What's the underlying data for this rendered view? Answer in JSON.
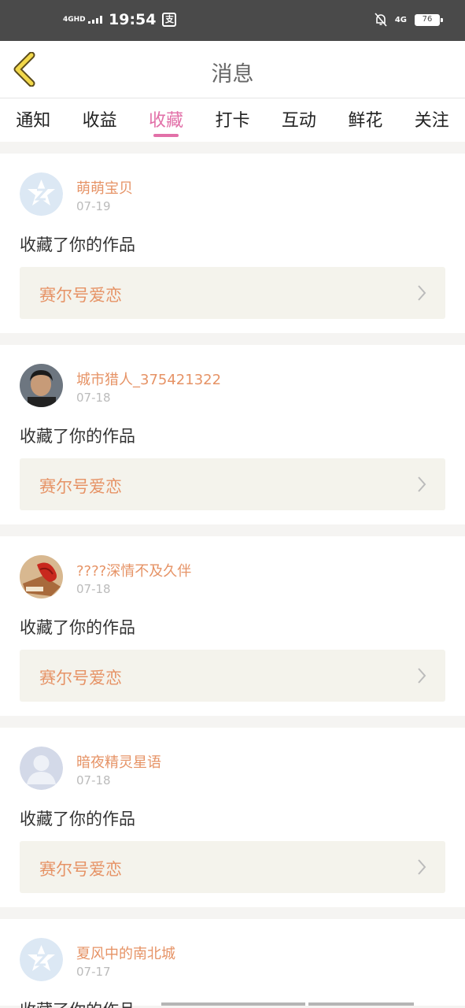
{
  "status_bar": {
    "network_label": "4GHD",
    "time": "19:54",
    "app_badge": "支",
    "data_label": "4G",
    "battery": "76"
  },
  "nav": {
    "title": "消息"
  },
  "tabs": [
    {
      "label": "通知",
      "active": false
    },
    {
      "label": "收益",
      "active": false
    },
    {
      "label": "收藏",
      "active": true
    },
    {
      "label": "打卡",
      "active": false
    },
    {
      "label": "互动",
      "active": false
    },
    {
      "label": "鲜花",
      "active": false
    },
    {
      "label": "关注",
      "active": false
    }
  ],
  "feed": [
    {
      "user": "萌萌宝贝",
      "date": "07-19",
      "action": "收藏了你的作品",
      "work": "赛尔号爱恋",
      "avatar": "default-star-avatar"
    },
    {
      "user": "城市猎人_375421322",
      "date": "07-18",
      "action": "收藏了你的作品",
      "work": "赛尔号爱恋",
      "avatar": "photo-avatar-person"
    },
    {
      "user": "????深情不及久伴",
      "date": "07-18",
      "action": "收藏了你的作品",
      "work": "赛尔号爱恋",
      "avatar": "photo-avatar-flower"
    },
    {
      "user": "暗夜精灵星语",
      "date": "07-18",
      "action": "收藏了你的作品",
      "work": "赛尔号爱恋",
      "avatar": "default-person-avatar"
    },
    {
      "user": "夏风中的南北城",
      "date": "07-17",
      "action": "收藏了你的作品",
      "avatar": "default-star-avatar"
    }
  ],
  "colors": {
    "accent": "#e270a8",
    "username": "#e69366",
    "work_bg": "#f4f3ec"
  }
}
